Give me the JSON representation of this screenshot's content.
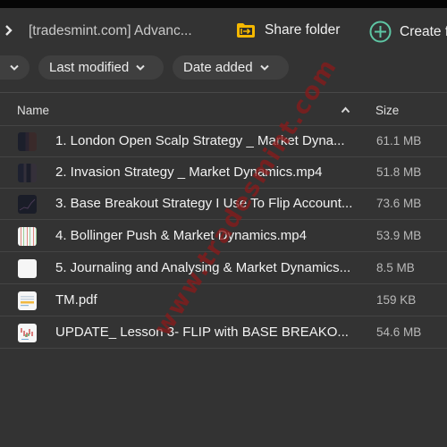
{
  "header": {
    "breadcrumb_title": "[tradesmint.com] Advanc...",
    "share_label": "Share folder",
    "create_label": "Create f"
  },
  "filters": [
    {
      "label": ""
    },
    {
      "label": "Last modified"
    },
    {
      "label": "Date added"
    }
  ],
  "columns": {
    "name": "Name",
    "size": "Size",
    "sort": "ascending"
  },
  "files": [
    {
      "name": "1. London Open Scalp Strategy _ Market Dyna...",
      "size": "61.1 MB",
      "thumb": "video-dark"
    },
    {
      "name": "2. Invasion Strategy _ Market Dynamics.mp4",
      "size": "51.8 MB",
      "thumb": "video-dark"
    },
    {
      "name": "3. Base Breakout Strategy I Use To Flip Account...",
      "size": "73.6 MB",
      "thumb": "video-chart"
    },
    {
      "name": "4. Bollinger Push & Market Dynamics.mp4",
      "size": "53.9 MB",
      "thumb": "video-light"
    },
    {
      "name": "5. Journaling and Analysing & Market Dynamics...",
      "size": "8.5 MB",
      "thumb": "blank-white"
    },
    {
      "name": "TM.pdf",
      "size": "159 KB",
      "thumb": "pdf"
    },
    {
      "name": "UPDATE_ Lesson 3- FLIP with BASE BREAKO...",
      "size": "54.6 MB",
      "thumb": "chart-white"
    }
  ],
  "watermark": "www.tradesmint.com",
  "colors": {
    "background": "#333333",
    "share_icon": "#f5b800",
    "create_icon": "#5ec6a4",
    "watermark": "#8a1a1a"
  }
}
